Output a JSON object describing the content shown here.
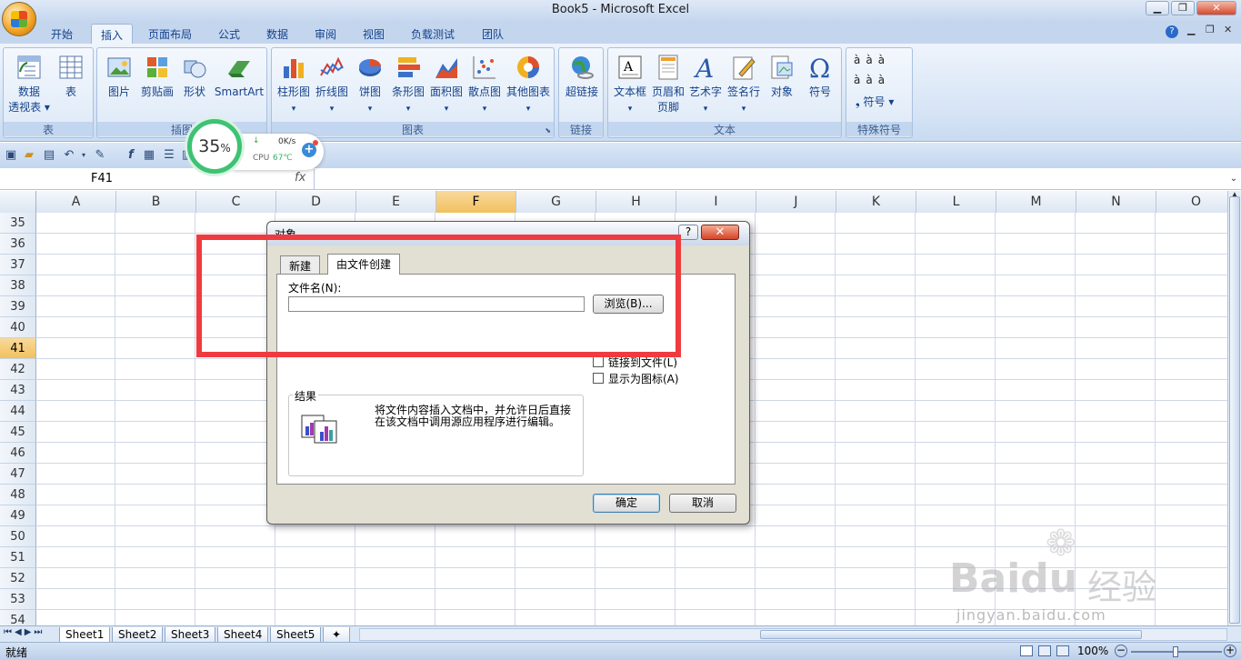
{
  "window": {
    "title": "Book5 - Microsoft Excel"
  },
  "ribbon_tabs": [
    "开始",
    "插入",
    "页面布局",
    "公式",
    "数据",
    "审阅",
    "视图",
    "负载测试",
    "团队"
  ],
  "ribbon": {
    "groups": {
      "tables": "表",
      "illustrations": "插图",
      "charts": "图表",
      "links": "链接",
      "text": "文本",
      "symbols": "特殊符号"
    },
    "buttons": {
      "pivot_line1": "数据",
      "pivot_line2": "透视表 ▾",
      "table": "表",
      "picture": "图片",
      "clipart": "剪贴画",
      "shapes": "形状",
      "smartart": "SmartArt",
      "column": "柱形图",
      "line": "折线图",
      "pie": "饼图",
      "bar": "条形图",
      "area": "面积图",
      "scatter": "散点图",
      "other": "其他图表",
      "hyperlink": "超链接",
      "textbox": "文本框",
      "header_line1": "页眉和",
      "header_line2": "页脚",
      "wordart": "艺术字",
      "signature": "签名行",
      "object": "对象",
      "symbol": "符号",
      "symbol_small": "符号 ▾",
      "accent": "à"
    }
  },
  "formula_bar": {
    "name_box": "F41",
    "fx": "fx"
  },
  "columns": [
    "A",
    "B",
    "C",
    "D",
    "E",
    "F",
    "G",
    "H",
    "I",
    "J",
    "K",
    "L",
    "M",
    "N",
    "O"
  ],
  "selected_column": "F",
  "rows": [
    "35",
    "36",
    "37",
    "38",
    "39",
    "40",
    "41",
    "42",
    "43",
    "44",
    "45",
    "46",
    "47",
    "48",
    "49",
    "50",
    "51",
    "52",
    "53",
    "54"
  ],
  "selected_row": "41",
  "sheets": [
    "Sheet1",
    "Sheet2",
    "Sheet3",
    "Sheet4",
    "Sheet5"
  ],
  "status": {
    "ready": "就绪",
    "zoom": "100%"
  },
  "widget": {
    "percent": "35",
    "percent_sign": "%",
    "speed": "0K/s",
    "cpu_label": "CPU",
    "cpu_temp": "67℃"
  },
  "dialog": {
    "title": "对象",
    "tabs": [
      "新建",
      "由文件创建"
    ],
    "filename_label": "文件名(N):",
    "filename_value": "",
    "browse": "浏览(B)...",
    "link_to_file": "链接到文件(L)",
    "display_as_icon": "显示为图标(A)",
    "result_label": "结果",
    "result_text": "将文件内容插入文档中，并允许日后直接在该文档中调用源应用程序进行编辑。",
    "ok": "确定",
    "cancel": "取消"
  },
  "watermark": {
    "brand": "Baidu",
    "cn": "经验",
    "url": "jingyan.baidu.com"
  }
}
